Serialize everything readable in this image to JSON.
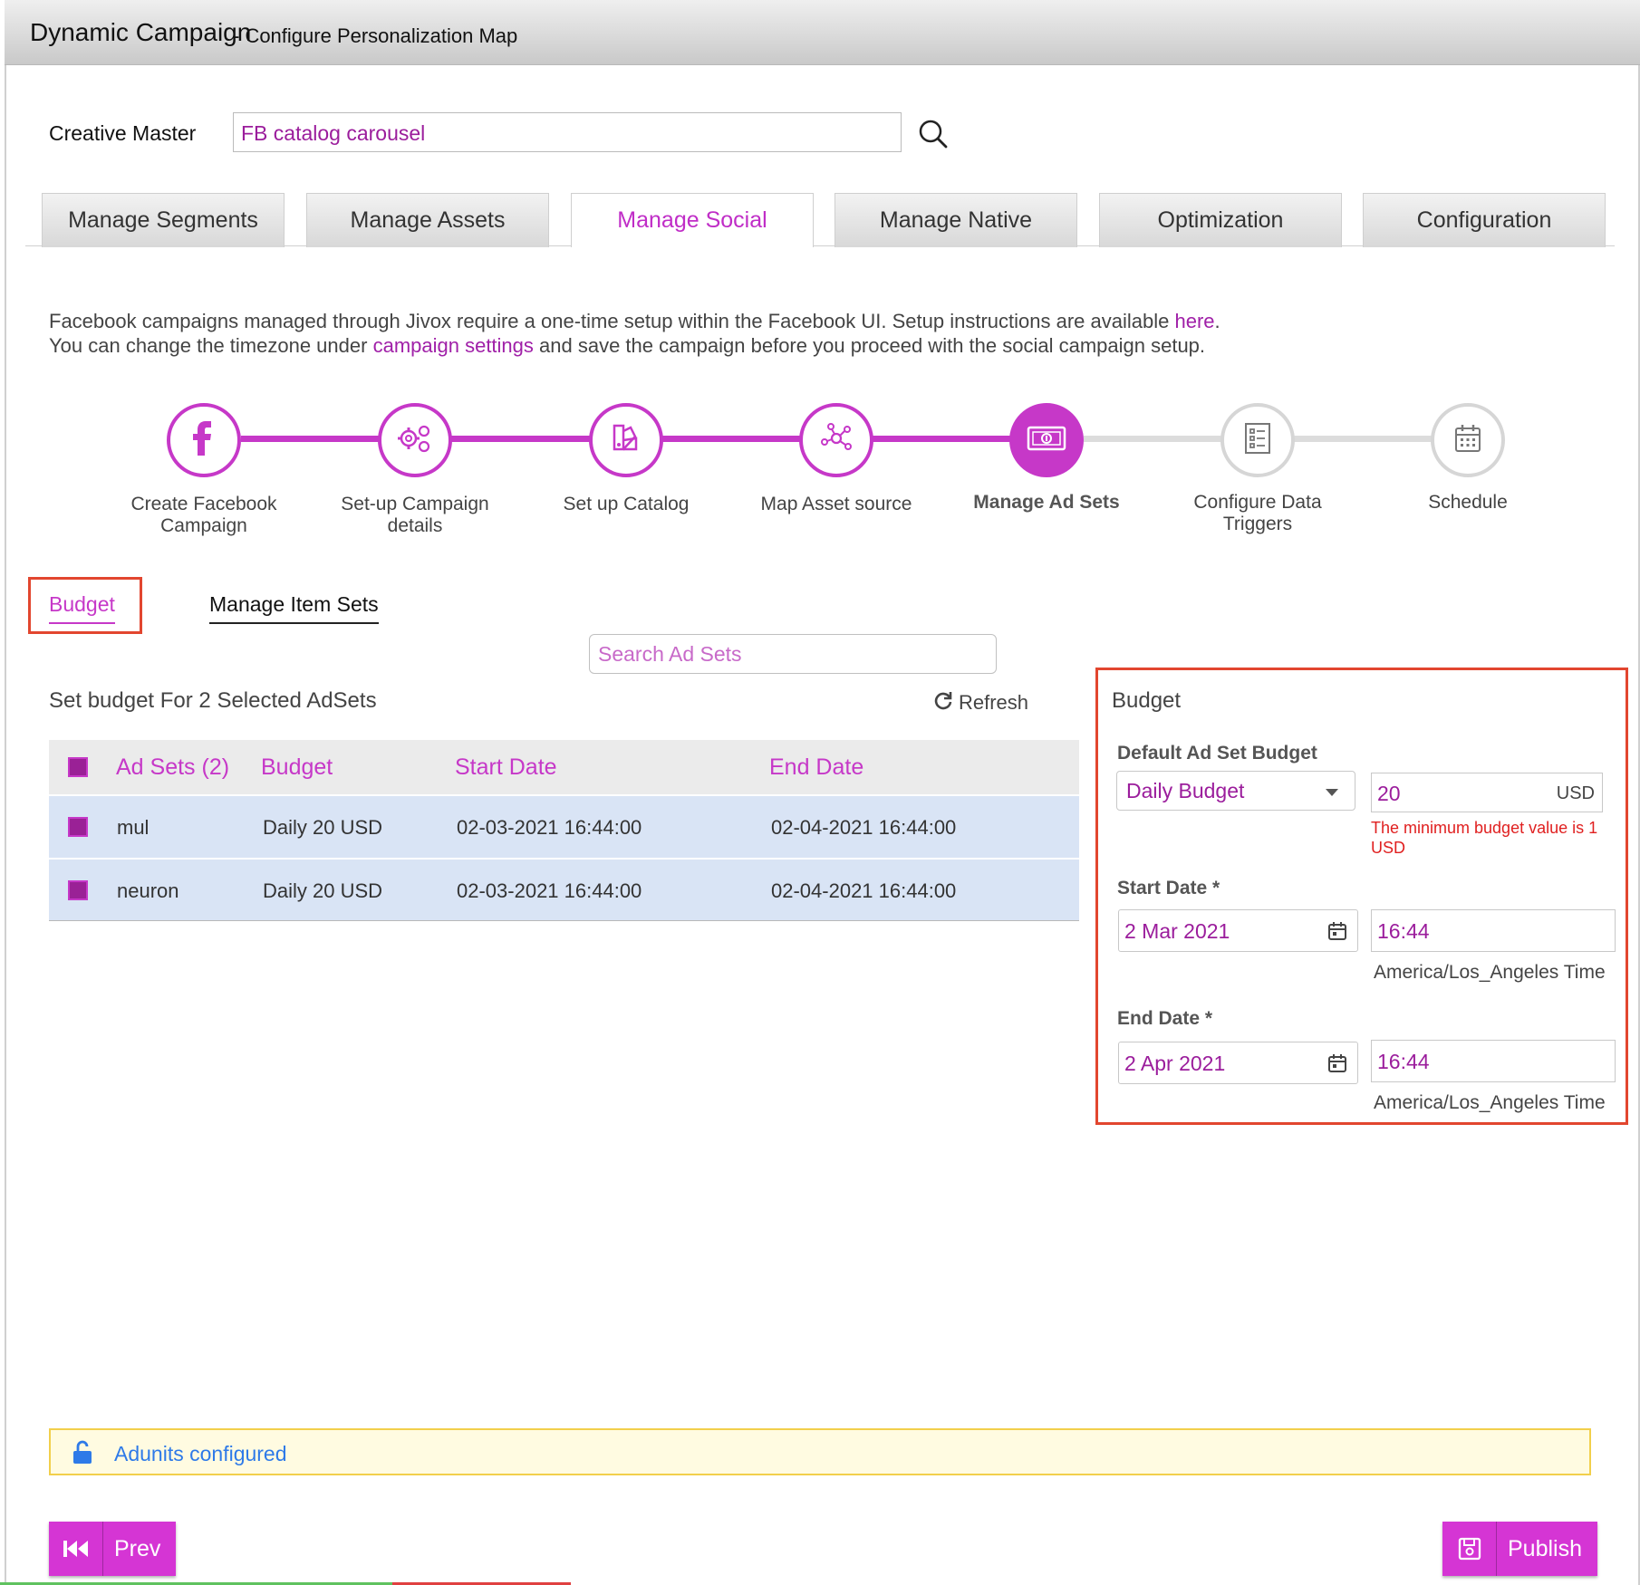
{
  "window": {
    "title": "Dynamic Campaign",
    "subtitle": "- Configure Personalization Map"
  },
  "creative_master": {
    "label": "Creative Master",
    "value": "FB catalog carousel"
  },
  "tabs": [
    {
      "label": "Manage Segments"
    },
    {
      "label": "Manage Assets"
    },
    {
      "label": "Manage Social"
    },
    {
      "label": "Manage Native"
    },
    {
      "label": "Optimization"
    },
    {
      "label": "Configuration"
    }
  ],
  "active_tab": "Manage Social",
  "info": {
    "line1_prefix": "Facebook campaigns managed through Jivox require a one-time setup within the Facebook UI. Setup instructions are available ",
    "line1_link": "here",
    "line1_suffix": ".",
    "line2_prefix": "You can change the timezone under ",
    "line2_link": "campaign settings",
    "line2_suffix": " and save the campaign before you proceed with the social campaign setup."
  },
  "steps": [
    {
      "label_line1": "Create Facebook",
      "label_line2": "Campaign",
      "icon": "facebook-icon",
      "state": "done"
    },
    {
      "label_line1": "Set-up Campaign",
      "label_line2": "details",
      "icon": "gears-icon",
      "state": "done"
    },
    {
      "label_line1": "Set up Catalog",
      "label_line2": "",
      "icon": "catalog-icon",
      "state": "done"
    },
    {
      "label_line1": "Map Asset source",
      "label_line2": "",
      "icon": "network-icon",
      "state": "done"
    },
    {
      "label_line1": "Manage Ad Sets",
      "label_line2": "",
      "icon": "money-icon",
      "state": "current"
    },
    {
      "label_line1": "Configure Data",
      "label_line2": "Triggers",
      "icon": "checklist-icon",
      "state": "future"
    },
    {
      "label_line1": "Schedule",
      "label_line2": "",
      "icon": "calendar-icon",
      "state": "future"
    }
  ],
  "subtabs": {
    "budget": "Budget",
    "manage_item_sets": "Manage Item Sets"
  },
  "adset_search": {
    "placeholder": "Search Ad Sets"
  },
  "set_budget_text": "Set budget For 2 Selected AdSets",
  "refresh_label": "Refresh",
  "table": {
    "headers": [
      "Ad Sets (2)",
      "Budget",
      "Start Date",
      "End Date"
    ],
    "rows": [
      {
        "name": "mul",
        "budget": "Daily 20 USD",
        "start": "02-03-2021 16:44:00",
        "end": "02-04-2021 16:44:00",
        "checked": true
      },
      {
        "name": "neuron",
        "budget": "Daily 20 USD",
        "start": "02-03-2021 16:44:00",
        "end": "02-04-2021 16:44:00",
        "checked": true
      }
    ]
  },
  "budget_panel": {
    "title": "Budget",
    "default_label": "Default Ad Set Budget",
    "budget_type": "Daily Budget",
    "amount": "20",
    "currency": "USD",
    "error_line1": "The minimum budget value is 1",
    "error_line2": "USD",
    "start_label": "Start Date *",
    "start_date": "2 Mar 2021",
    "start_time": "16:44",
    "start_tz": "America/Los_Angeles Time",
    "end_label": "End Date *",
    "end_date": "2 Apr 2021",
    "end_time": "16:44",
    "end_tz": "America/Los_Angeles Time"
  },
  "adunits_text": "Adunits configured",
  "buttons": {
    "prev": "Prev",
    "publish": "Publish"
  },
  "colors": {
    "accent": "#c638c8",
    "value_text": "#9b1d9c",
    "error": "#e02020",
    "highlight_border": "#e2462f",
    "row_bg": "#d9e4f5",
    "notice_bg": "#fffbe1",
    "notice_border": "#f2cf4b",
    "link_blue": "#2e7ae8"
  }
}
